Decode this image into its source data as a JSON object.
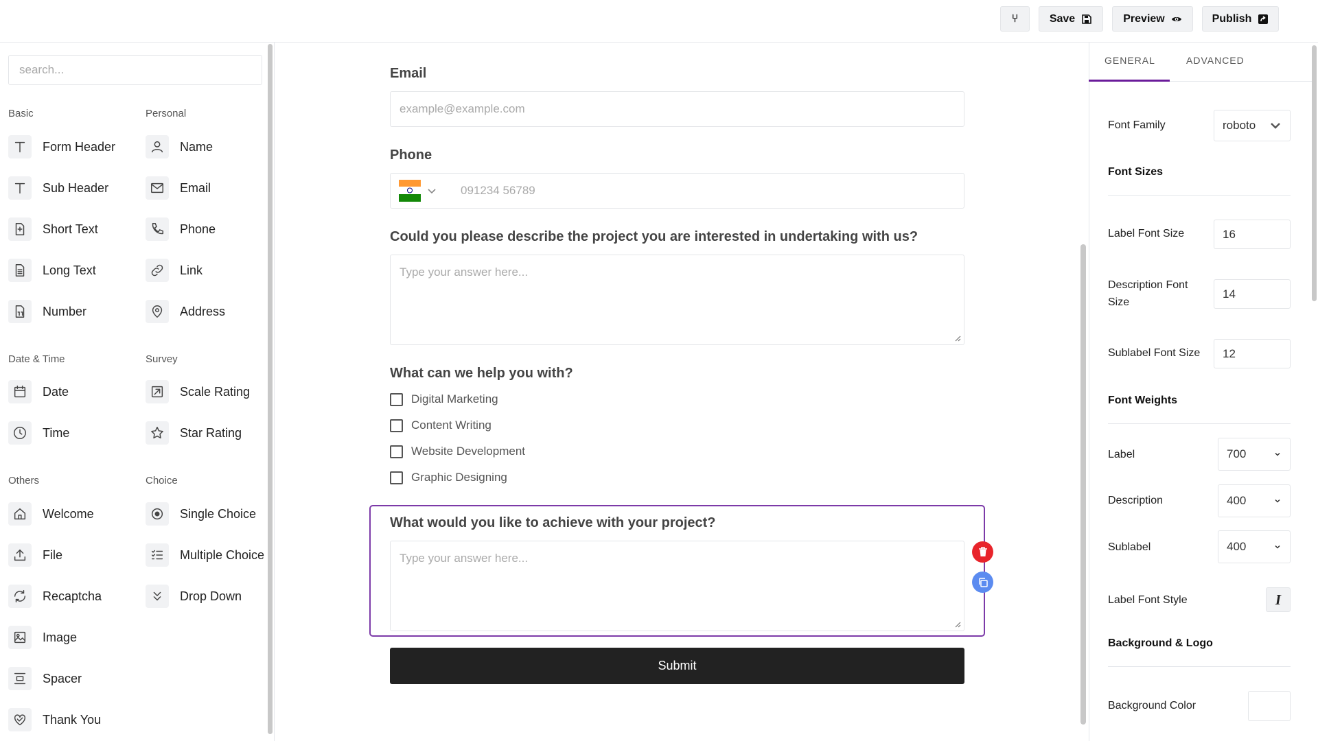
{
  "toolbar": {
    "branch_icon_label": "⑂",
    "save_label": "Save",
    "preview_label": "Preview",
    "publish_label": "Publish"
  },
  "palette": {
    "search_placeholder": "search...",
    "sections": {
      "basic": "Basic",
      "personal": "Personal",
      "datetime": "Date & Time",
      "survey": "Survey",
      "others": "Others",
      "choice": "Choice"
    },
    "basic": [
      "Form Header",
      "Sub Header",
      "Short Text",
      "Long Text",
      "Number"
    ],
    "personal": [
      "Name",
      "Email",
      "Phone",
      "Link",
      "Address"
    ],
    "datetime": [
      "Date",
      "Time"
    ],
    "survey": [
      "Scale Rating",
      "Star Rating"
    ],
    "others": [
      "Welcome",
      "File",
      "Recaptcha",
      "Image",
      "Spacer",
      "Thank You"
    ],
    "choice": [
      "Single Choice",
      "Multiple Choice",
      "Drop Down"
    ]
  },
  "form": {
    "email_label": "Email",
    "email_placeholder": "example@example.com",
    "phone_label": "Phone",
    "phone_placeholder": "091234 56789",
    "q1_label": "Could you please describe the project you are interested in undertaking with us?",
    "q1_placeholder": "Type your answer here...",
    "q2_label": "What can we help you with?",
    "q2_options": [
      "Digital Marketing",
      "Content Writing",
      "Website Development",
      "Graphic Designing"
    ],
    "q3_label": "What would you like to achieve with your project?",
    "q3_placeholder": "Type your answer here...",
    "submit_label": "Submit"
  },
  "settings": {
    "tabs": [
      "GENERAL",
      "ADVANCED"
    ],
    "font_family_label": "Font Family",
    "font_family_value": "roboto",
    "font_sizes_heading": "Font Sizes",
    "label_font_size_label": "Label Font Size",
    "label_font_size": "16",
    "description_font_size_label": "Description Font Size",
    "description_font_size": "14",
    "sublabel_font_size_label": "Sublabel Font Size",
    "sublabel_font_size": "12",
    "font_weights_heading": "Font Weights",
    "label_weight_label": "Label",
    "label_weight": "700",
    "description_weight_label": "Description",
    "description_weight": "400",
    "sublabel_weight_label": "Sublabel",
    "sublabel_weight": "400",
    "label_font_style_label": "Label Font Style",
    "italic_glyph": "I",
    "background_heading": "Background & Logo",
    "background_color_label": "Background Color"
  },
  "colors": {
    "accent": "#6a1b9a",
    "selected_border": "#7c3aa8",
    "delete": "#e8242b",
    "duplicate": "#5b8bf0",
    "submit_bg": "#222222"
  }
}
